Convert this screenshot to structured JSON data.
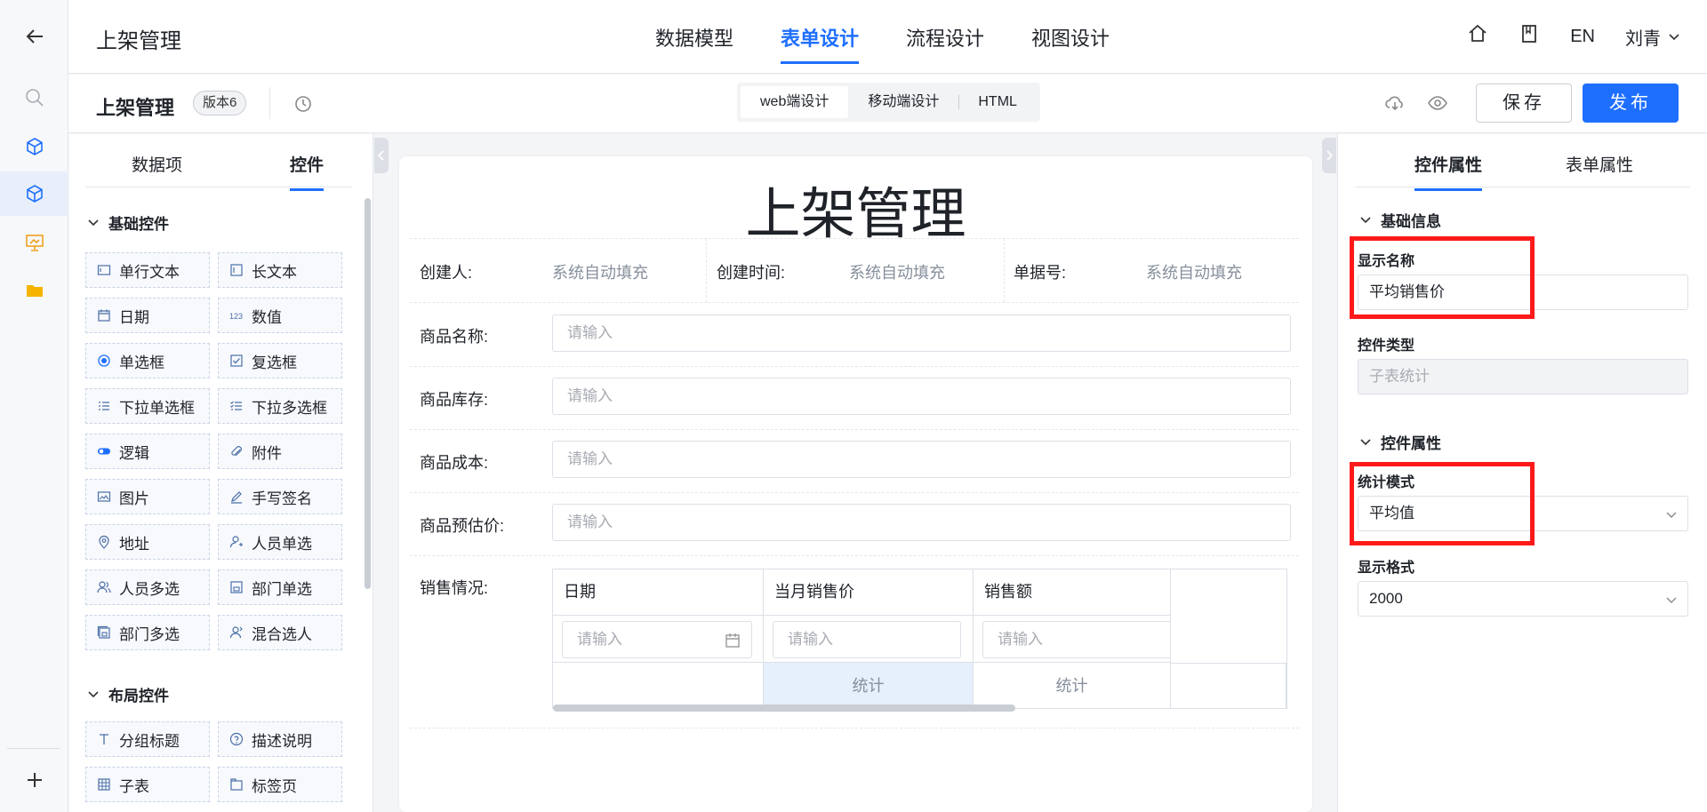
{
  "header": {
    "app_title": "上架管理",
    "tabs": [
      {
        "label": "数据模型",
        "active": false
      },
      {
        "label": "表单设计",
        "active": true
      },
      {
        "label": "流程设计",
        "active": false
      },
      {
        "label": "视图设计",
        "active": false
      }
    ],
    "lang": "EN",
    "user": "刘青"
  },
  "subbar": {
    "form_name": "上架管理",
    "version": "版本6",
    "modes": [
      {
        "label": "web端设计",
        "active": true
      },
      {
        "label": "移动端设计",
        "active": false
      },
      {
        "label": "HTML",
        "active": false
      }
    ],
    "save_label": "保存",
    "publish_label": "发布"
  },
  "left_panel": {
    "tabs": [
      {
        "label": "数据项",
        "active": false
      },
      {
        "label": "控件",
        "active": true
      }
    ],
    "basic_group": "基础控件",
    "basic_controls": [
      {
        "label": "单行文本",
        "icon": "single-line-text-icon"
      },
      {
        "label": "长文本",
        "icon": "long-text-icon"
      },
      {
        "label": "日期",
        "icon": "calendar-icon"
      },
      {
        "label": "数值",
        "icon": "number-icon"
      },
      {
        "label": "单选框",
        "icon": "radio-icon"
      },
      {
        "label": "复选框",
        "icon": "checkbox-icon"
      },
      {
        "label": "下拉单选框",
        "icon": "dropdown-single-icon"
      },
      {
        "label": "下拉多选框",
        "icon": "dropdown-multi-icon"
      },
      {
        "label": "逻辑",
        "icon": "toggle-icon"
      },
      {
        "label": "附件",
        "icon": "paperclip-icon"
      },
      {
        "label": "图片",
        "icon": "image-icon"
      },
      {
        "label": "手写签名",
        "icon": "pen-icon"
      },
      {
        "label": "地址",
        "icon": "location-icon"
      },
      {
        "label": "人员单选",
        "icon": "user-single-icon"
      },
      {
        "label": "人员多选",
        "icon": "user-multi-icon"
      },
      {
        "label": "部门单选",
        "icon": "department-single-icon"
      },
      {
        "label": "部门多选",
        "icon": "department-multi-icon"
      },
      {
        "label": "混合选人",
        "icon": "user-mixed-icon"
      }
    ],
    "layout_group": "布局控件",
    "layout_controls": [
      {
        "label": "分组标题",
        "icon": "text-heading-icon"
      },
      {
        "label": "描述说明",
        "icon": "help-circle-icon"
      },
      {
        "label": "子表",
        "icon": "table-icon"
      },
      {
        "label": "标签页",
        "icon": "tabs-icon"
      }
    ]
  },
  "form": {
    "title": "上架管理",
    "meta": [
      {
        "label": "创建人:",
        "value": "系统自动填充"
      },
      {
        "label": "创建时间:",
        "value": "系统自动填充"
      },
      {
        "label": "单据号:",
        "value": "系统自动填充"
      }
    ],
    "fields": [
      {
        "label": "商品名称:",
        "placeholder": "请输入"
      },
      {
        "label": "商品库存:",
        "placeholder": "请输入"
      },
      {
        "label": "商品成本:",
        "placeholder": "请输入"
      },
      {
        "label": "商品预估价:",
        "placeholder": "请输入"
      }
    ],
    "subtable": {
      "label": "销售情况:",
      "columns": [
        "日期",
        "当月销售价",
        "销售额"
      ],
      "placeholders": [
        "请输入",
        "请输入",
        "请输入"
      ],
      "stats": [
        "统计",
        "统计"
      ]
    }
  },
  "right_panel": {
    "tabs": [
      {
        "label": "控件属性",
        "active": true
      },
      {
        "label": "表单属性",
        "active": false
      }
    ],
    "basic_info": "基础信息",
    "display_name_label": "显示名称",
    "display_name_value": "平均销售价",
    "control_type_label": "控件类型",
    "control_type_value": "子表统计",
    "control_props": "控件属性",
    "stat_mode_label": "统计模式",
    "stat_mode_value": "平均值",
    "display_format_label": "显示格式",
    "display_format_value": "2000"
  },
  "colors": {
    "accent": "#1f6fff",
    "highlight": "#ff1a1a",
    "stat_selected_bg": "#e6effc"
  }
}
